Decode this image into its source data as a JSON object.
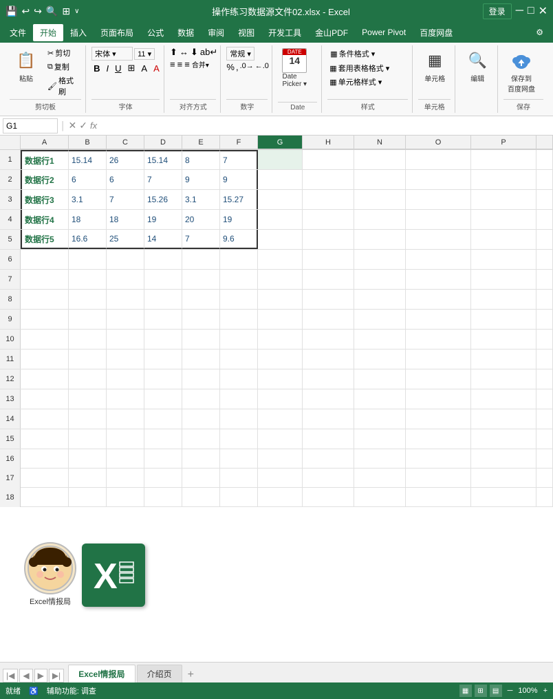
{
  "titlebar": {
    "title": "操作练习数据源文件02.xlsx - Excel",
    "login_label": "登录",
    "save_icon": "💾",
    "undo_icon": "↩",
    "redo_icon": "↪",
    "search_icon": "🔍",
    "group_icon": "⊞",
    "more_icon": "∨"
  },
  "menubar": {
    "items": [
      "文件",
      "开始",
      "插入",
      "页面布局",
      "公式",
      "数据",
      "审阅",
      "视图",
      "开发工具",
      "金山PDF",
      "Power Pivot",
      "百度网盘",
      "⚙"
    ]
  },
  "ribbon": {
    "clipboard_label": "剪切板",
    "paste_label": "粘贴",
    "cut_label": "✂",
    "copy_label": "⧉",
    "format_label": "⊞",
    "font_label": "字体",
    "align_label": "对齐方式",
    "number_label": "数字",
    "date_label": "Date",
    "datepicker_label": "Date\nPicker",
    "styles_label": "样式",
    "conditional_label": "条件格式 ▾",
    "table_style_label": "套用表格格式 ▾",
    "cell_style_label": "单元格样式 ▾",
    "cell_group_label": "单元格",
    "cell_btn_label": "单元格",
    "edit_label": "编辑",
    "edit_icon": "🔍",
    "save_cloud_label": "保存到\n百度网盘",
    "save_group_label": "保存"
  },
  "formula_bar": {
    "cell_ref": "G1",
    "formula_content": ""
  },
  "columns": {
    "headers": [
      "A",
      "B",
      "C",
      "D",
      "E",
      "F",
      "G",
      "H",
      "N",
      "O",
      "P"
    ]
  },
  "rows": [
    {
      "num": "1",
      "cells": {
        "A": "数据行1",
        "B": "15.14",
        "C": "26",
        "D": "15.14",
        "E": "8",
        "F": "7",
        "G": "",
        "H": "",
        "N": "",
        "O": "",
        "P": ""
      }
    },
    {
      "num": "2",
      "cells": {
        "A": "数据行2",
        "B": "6",
        "C": "6",
        "D": "7",
        "E": "9",
        "F": "9",
        "G": "",
        "H": "",
        "N": "",
        "O": "",
        "P": ""
      }
    },
    {
      "num": "3",
      "cells": {
        "A": "数据行3",
        "B": "3.1",
        "C": "7",
        "D": "15.26",
        "E": "3.1",
        "F": "15.27",
        "G": "",
        "H": "",
        "N": "",
        "O": "",
        "P": ""
      }
    },
    {
      "num": "4",
      "cells": {
        "A": "数据行4",
        "B": "18",
        "C": "18",
        "D": "19",
        "E": "20",
        "F": "19",
        "G": "",
        "H": "",
        "N": "",
        "O": "",
        "P": ""
      }
    },
    {
      "num": "5",
      "cells": {
        "A": "数据行5",
        "B": "16.6",
        "C": "25",
        "D": "14",
        "E": "7",
        "F": "9.6",
        "G": "",
        "H": "",
        "N": "",
        "O": "",
        "P": ""
      }
    },
    {
      "num": "6",
      "cells": {
        "A": "",
        "B": "",
        "C": "",
        "D": "",
        "E": "",
        "F": "",
        "G": "",
        "H": "",
        "N": "",
        "O": "",
        "P": ""
      }
    },
    {
      "num": "7",
      "cells": {
        "A": "",
        "B": "",
        "C": "",
        "D": "",
        "E": "",
        "F": "",
        "G": "",
        "H": "",
        "N": "",
        "O": "",
        "P": ""
      }
    },
    {
      "num": "8",
      "cells": {
        "A": "",
        "B": "",
        "C": "",
        "D": "",
        "E": "",
        "F": "",
        "G": "",
        "H": "",
        "N": "",
        "O": "",
        "P": ""
      }
    },
    {
      "num": "9",
      "cells": {
        "A": "",
        "B": "",
        "C": "",
        "D": "",
        "E": "",
        "F": "",
        "G": "",
        "H": "",
        "N": "",
        "O": "",
        "P": ""
      }
    },
    {
      "num": "10",
      "cells": {
        "A": "",
        "B": "",
        "C": "",
        "D": "",
        "E": "",
        "F": "",
        "G": "",
        "H": "",
        "N": "",
        "O": "",
        "P": ""
      }
    },
    {
      "num": "11",
      "cells": {
        "A": "",
        "B": "",
        "C": "",
        "D": "",
        "E": "",
        "F": "",
        "G": "",
        "H": "",
        "N": "",
        "O": "",
        "P": ""
      }
    },
    {
      "num": "12",
      "cells": {
        "A": "",
        "B": "",
        "C": "",
        "D": "",
        "E": "",
        "F": "",
        "G": "",
        "H": "",
        "N": "",
        "O": "",
        "P": ""
      }
    },
    {
      "num": "13",
      "cells": {
        "A": "",
        "B": "",
        "C": "",
        "D": "",
        "E": "",
        "F": "",
        "G": "",
        "H": "",
        "N": "",
        "O": "",
        "P": ""
      }
    },
    {
      "num": "14",
      "cells": {
        "A": "",
        "B": "",
        "C": "",
        "D": "",
        "E": "",
        "F": "",
        "G": "",
        "H": "",
        "N": "",
        "O": "",
        "P": ""
      }
    },
    {
      "num": "15",
      "cells": {
        "A": "",
        "B": "",
        "C": "",
        "D": "",
        "E": "",
        "F": "",
        "G": "",
        "H": "",
        "N": "",
        "O": "",
        "P": ""
      }
    },
    {
      "num": "16",
      "cells": {
        "A": "",
        "B": "",
        "C": "",
        "D": "",
        "E": "",
        "F": "",
        "G": "",
        "H": "",
        "N": "",
        "O": "",
        "P": ""
      }
    },
    {
      "num": "17",
      "cells": {
        "A": "",
        "B": "",
        "C": "",
        "D": "",
        "E": "",
        "F": "",
        "G": "",
        "H": "",
        "N": "",
        "O": "",
        "P": ""
      }
    },
    {
      "num": "18",
      "cells": {
        "A": "",
        "B": "",
        "C": "",
        "D": "",
        "E": "",
        "F": "",
        "G": "",
        "H": "",
        "N": "",
        "O": "",
        "P": ""
      }
    }
  ],
  "sheets": {
    "tabs": [
      "Excel情报局",
      "介绍页"
    ],
    "active": "Excel情报局",
    "add_label": "+"
  },
  "statusbar": {
    "ready_label": "就绪",
    "accessibility_label": "辅助功能: 调查",
    "page_label": ""
  },
  "logo": {
    "avatar_emoji": "🧒",
    "brand_label": "Excel情报局"
  }
}
